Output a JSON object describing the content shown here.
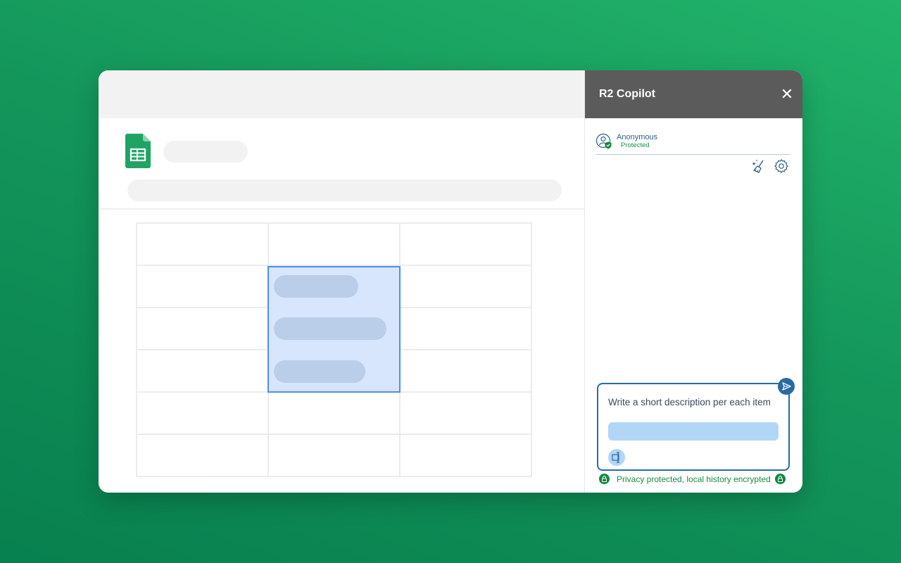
{
  "panel": {
    "title": "R2 Copilot",
    "close_label": "✕",
    "user": {
      "name": "Anonymous",
      "status": "Protected"
    },
    "composer": {
      "text": "Write a short description per each item"
    },
    "privacy_text": "Privacy protected, local history encrypted"
  },
  "colors": {
    "background": "#1aa565",
    "panel_header": "#5b5b5b",
    "accent": "#2a6aa3",
    "selection_fill": "#d7e6fc",
    "selection_border": "#4d90f0",
    "privacy_green": "#1a8a3f"
  },
  "icons": {
    "app_logo": "google-sheets-icon",
    "close": "close-icon",
    "user": "user-shield-icon",
    "clean": "broom-sparkle-icon",
    "settings": "gear-icon",
    "send": "send-icon",
    "context": "text-cursor-icon",
    "lock": "lock-icon"
  }
}
